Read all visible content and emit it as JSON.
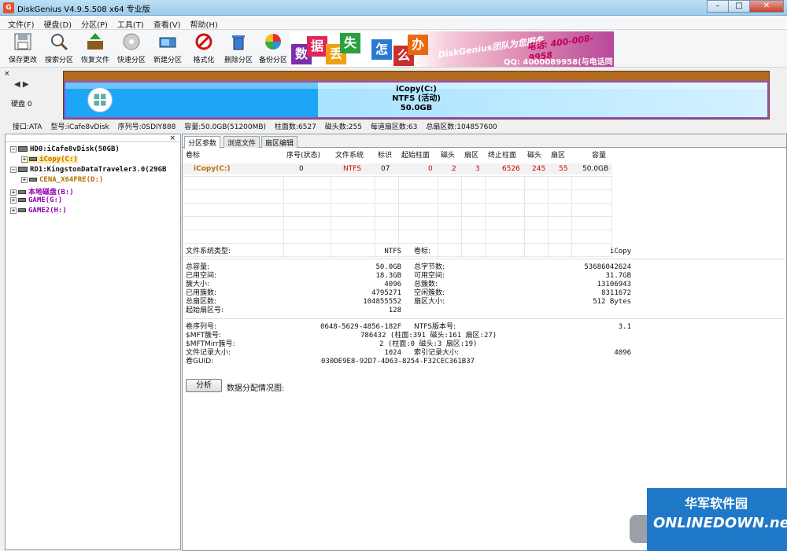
{
  "window": {
    "title": "DiskGenius V4.9.5.508 x64 专业版",
    "app_icon": "G",
    "min": "–",
    "max": "□",
    "close": "✕"
  },
  "menu": [
    "文件(F)",
    "硬盘(D)",
    "分区(P)",
    "工具(T)",
    "查看(V)",
    "帮助(H)"
  ],
  "toolbar": [
    {
      "label": "保存更改",
      "icon": "save-icon"
    },
    {
      "label": "搜索分区",
      "icon": "search-icon"
    },
    {
      "label": "恢复文件",
      "icon": "recover-icon"
    },
    {
      "label": "快速分区",
      "icon": "quick-partition-icon"
    },
    {
      "label": "新建分区",
      "icon": "new-partition-icon"
    },
    {
      "label": "格式化",
      "icon": "format-icon"
    },
    {
      "label": "删除分区",
      "icon": "delete-icon"
    },
    {
      "label": "备份分区",
      "icon": "backup-icon"
    }
  ],
  "banner": {
    "tiles": [
      "数",
      "据",
      "丢",
      "失",
      "怎",
      "么",
      "办"
    ],
    "team": "DiskGenius团队为您服务",
    "phone": "电话: 400-008-9958",
    "qq": "QQ: 4000089958(与电话同号)"
  },
  "disk": {
    "close": "×",
    "arrows": "◀ ▶",
    "label": "硬盘 0",
    "partition_name": "iCopy(C:)",
    "partition_fs": "NTFS (活动)",
    "partition_size": "50.0GB"
  },
  "disk_info": {
    "interface": "接口:ATA",
    "model": "型号:iCafe8vDisk",
    "serial": "序列号:0SDIY888",
    "capacity": "容量:50.0GB(51200MB)",
    "cylinders": "柱面数:6527",
    "heads": "磁头数:255",
    "sectors_per_track": "每道扇区数:63",
    "total_sectors": "总扇区数:104857600"
  },
  "tree": {
    "close": "×",
    "nodes": [
      {
        "text": "HD0:iCafe8vDisk(50GB)",
        "color": "#000000",
        "pm": "−"
      },
      {
        "text": "iCopy(C:)",
        "color": "#c07000",
        "pm": "+"
      },
      {
        "text": "RD1:KingstonDataTraveler3.0(29GB",
        "color": "#000000",
        "pm": "−"
      },
      {
        "text": "CENA_X64FRE(D:)",
        "color": "#b07000",
        "pm": "+"
      },
      {
        "text": "本地磁盘(B:)",
        "color": "#9000b0",
        "pm": "+"
      },
      {
        "text": "GAME(G:)",
        "color": "#9000b0",
        "pm": "+"
      },
      {
        "text": "GAME2(H:)",
        "color": "#9000b0",
        "pm": "+"
      }
    ]
  },
  "tabs": [
    "分区参数",
    "浏览文件",
    "扇区编辑"
  ],
  "partition_table": {
    "headers": [
      "卷标",
      "序号(状态)",
      "文件系统",
      "标识",
      "起始柱面",
      "磁头",
      "扇区",
      "终止柱面",
      "磁头",
      "扇区",
      "容量"
    ],
    "row": [
      "iCopy(C:)",
      "0",
      "NTFS",
      "07",
      "0",
      "2",
      "3",
      "6526",
      "245",
      "55",
      "50.0GB"
    ]
  },
  "details": {
    "fs_type_label": "文件系统类型:",
    "fs_type": "NTFS",
    "volume_label_label": "卷标:",
    "volume_label": "iCopy",
    "total_capacity_label": "总容量:",
    "total_capacity": "50.0GB",
    "total_bytes_label": "总字节数:",
    "total_bytes": "53686042624",
    "used_label": "已用空间:",
    "used": "18.3GB",
    "free_label": "可用空间:",
    "free": "31.7GB",
    "cluster_size_label": "簇大小:",
    "cluster_size": "4096",
    "total_clusters_label": "总簇数:",
    "total_clusters": "13106943",
    "used_clusters_label": "已用簇数:",
    "used_clusters": "4795271",
    "free_clusters_label": "空闲簇数:",
    "free_clusters": "8311672",
    "total_sectors_label": "总扇区数:",
    "total_sectors": "104855552",
    "sector_size_label": "扇区大小:",
    "sector_size": "512 Bytes",
    "start_sector_label": "起始扇区号:",
    "start_sector": "128",
    "serial_label": "卷序列号:",
    "serial": "0648-5629-4856-182F",
    "ntfs_version_label": "NTFS版本号:",
    "ntfs_version": "3.1",
    "mft_label": "$MFT簇号:",
    "mft": "786432 (柱面:391 磁头:161 扇区:27)",
    "mftmirr_label": "$MFTMirr簇号:",
    "mftmirr": "2 (柱面:0 磁头:3 扇区:19)",
    "file_record_label": "文件记录大小:",
    "file_record": "1024",
    "index_record_label": "索引记录大小:",
    "index_record": "4096",
    "guid_label": "卷GUID:",
    "guid": "030DE9E8-92D7-4D63-8254-F32CEC361B37"
  },
  "analyze": {
    "button": "分析",
    "label": "数据分配情况图:"
  },
  "watermark": {
    "cn": "华军软件园",
    "en": "ONLINEDOWN.net"
  }
}
